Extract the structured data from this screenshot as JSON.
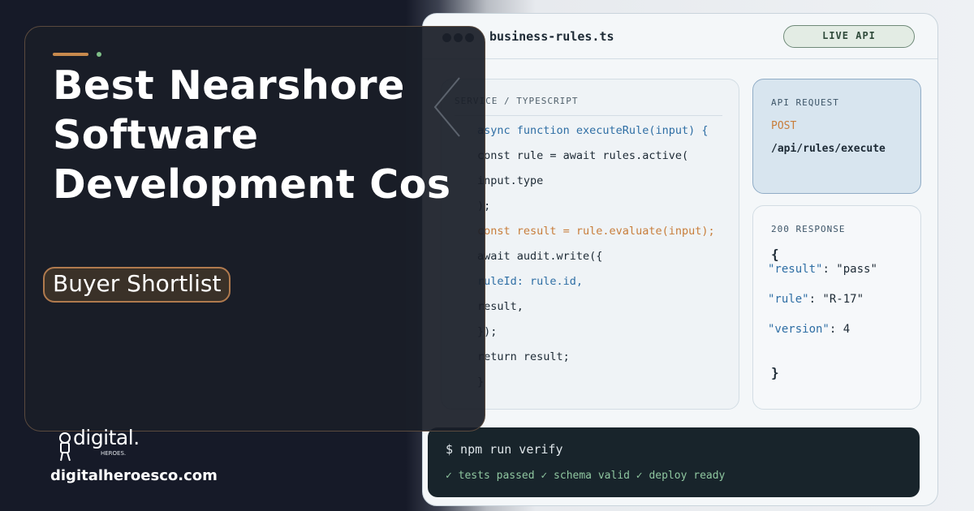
{
  "editor": {
    "filename": "business-rules.ts",
    "badge": "LIVE API"
  },
  "code": {
    "label": "SERVICE / TYPESCRIPT",
    "lines": [
      {
        "t": "async function executeRule(input) {"
      },
      {
        "t": "const rule = await rules.active("
      },
      {
        "t": "input.type"
      },
      {
        "t": ");"
      },
      {
        "t": "const result = rule.evaluate(input);"
      },
      {
        "t": "await audit.write({"
      },
      {
        "t": "ruleId: rule.id,"
      },
      {
        "t": "result,"
      },
      {
        "t": "});"
      },
      {
        "t": "return result;"
      },
      {
        "t": "}"
      }
    ]
  },
  "api_request": {
    "label": "API REQUEST",
    "method": "POST",
    "path": "/api/rules/execute"
  },
  "response": {
    "label": "200 RESPONSE",
    "open": "{",
    "close": "}",
    "entries": [
      {
        "key": "\"result\"",
        "value": ": \"pass\""
      },
      {
        "key": "\"rule\"",
        "value": ": \"R-17\""
      },
      {
        "key": "\"version\"",
        "value": ": 4"
      }
    ]
  },
  "terminal": {
    "command": "$ npm run verify",
    "output": "✓ tests passed ✓ schema valid ✓ deploy ready"
  },
  "hero": {
    "headline": "Best Nearshore Software Development Cos",
    "tag": "Buyer Shortlist"
  },
  "brand": {
    "logo_text": "digital.",
    "logo_sub": "HEROES.",
    "url": "digitalheroesco.com"
  },
  "colors": {
    "accent": "#c88a4d",
    "code_keyword": "#2e6ea4",
    "code_highlight": "#c87d3a",
    "terminal_ok": "#8fc7a0"
  }
}
